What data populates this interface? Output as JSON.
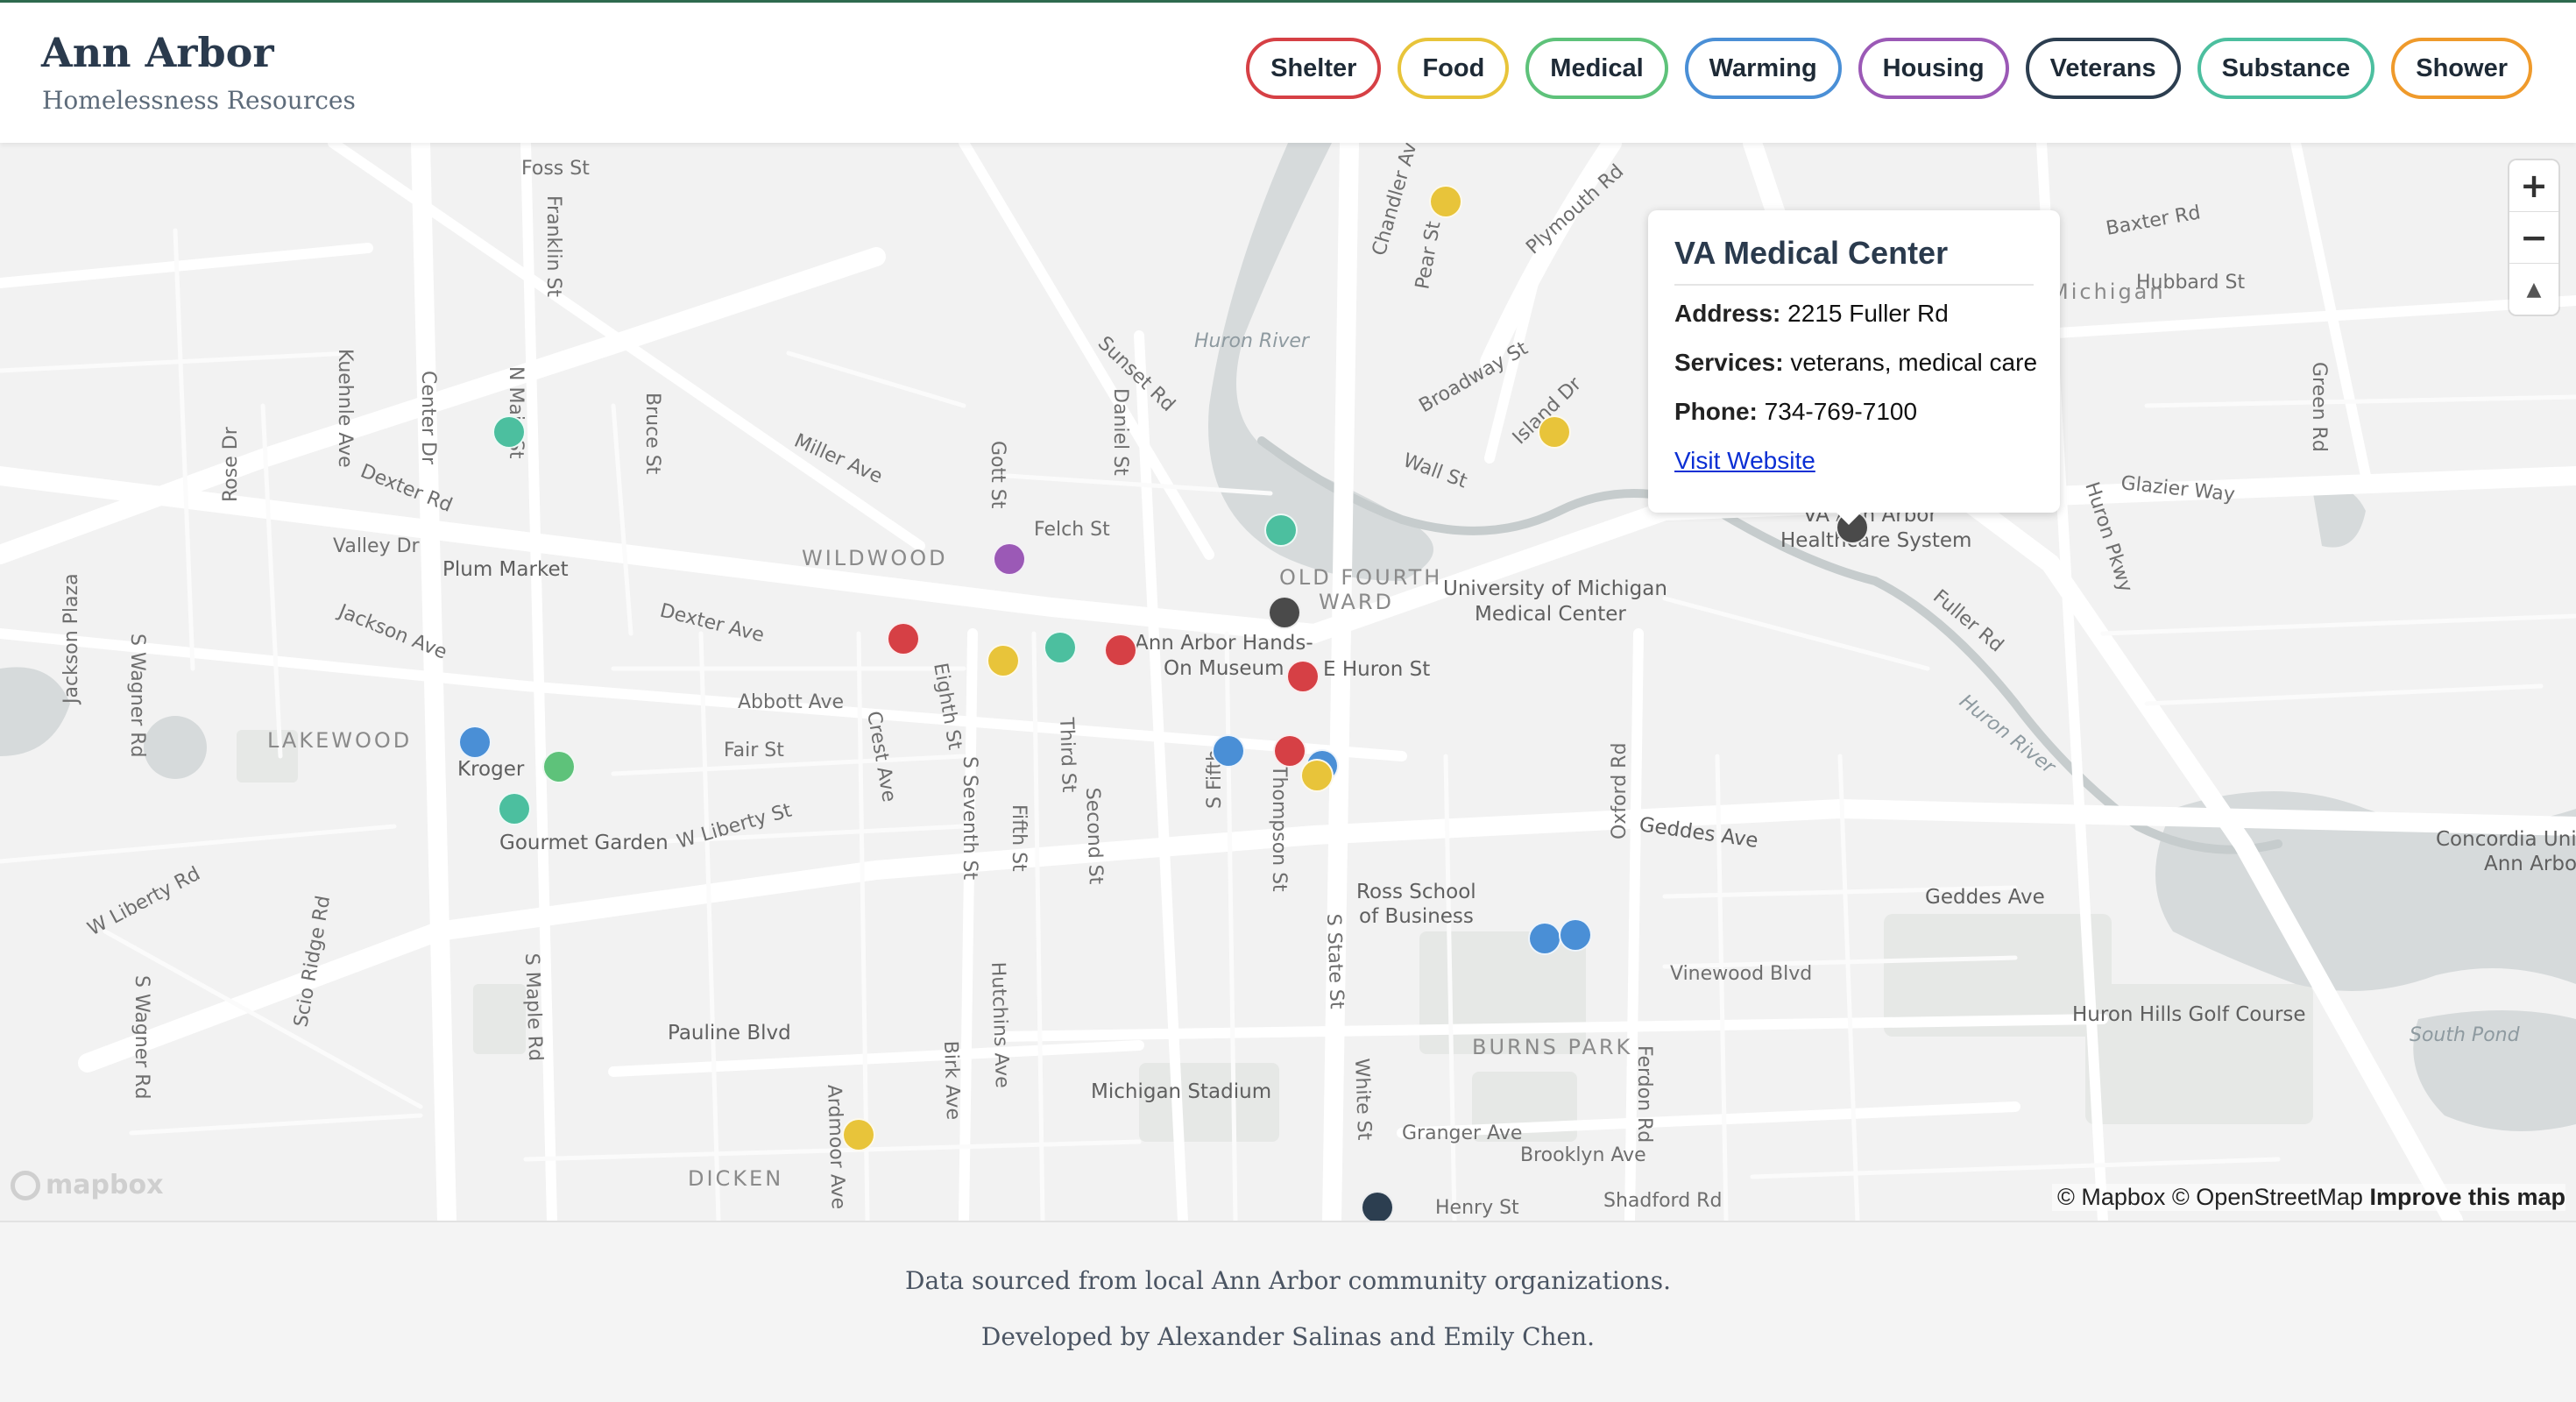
{
  "header": {
    "title": "Ann Arbor",
    "subtitle": "Homelessness Resources"
  },
  "filters": [
    {
      "label": "Shelter",
      "color": "#d64045"
    },
    {
      "label": "Food",
      "color": "#e8c43a"
    },
    {
      "label": "Medical",
      "color": "#5ec27a"
    },
    {
      "label": "Warming",
      "color": "#4a8fd6"
    },
    {
      "label": "Housing",
      "color": "#9b59b6"
    },
    {
      "label": "Veterans",
      "color": "#2c3e50"
    },
    {
      "label": "Substance",
      "color": "#4cbf9f"
    },
    {
      "label": "Shower",
      "color": "#ef9a2b"
    }
  ],
  "map": {
    "controls": {
      "zoom_in": "+",
      "zoom_out": "−",
      "compass": "▲"
    },
    "labels": {
      "streets": [
        "Foss St",
        "Franklin St",
        "N Main St",
        "Kuehnle Ave",
        "Center Dr",
        "Bruce St",
        "Rose Dr",
        "Dexter Rd",
        "Valley Dr",
        "Plum Market",
        "Miller Ave",
        "Felch St",
        "Gott St",
        "Sunset Rd",
        "Daniel St",
        "Chandler Ave",
        "Pear St",
        "Plymouth Rd",
        "Broadway St",
        "Wall St",
        "Baxter Rd",
        "Hubbard St",
        "Green Rd",
        "Glazier Way",
        "Huron Pkwy",
        "Fuller Rd",
        "Jackson Ave",
        "Dexter Ave",
        "Jackson Plaza",
        "S Wagner Rd",
        "Abbott Ave",
        "Fair St",
        "Crest Ave",
        "Eighth St",
        "S Seventh St",
        "Third St",
        "Second St",
        "Fifth St",
        "S Fifth",
        "Thompson St",
        "E Huron St",
        "Kroger",
        "Gourmet Garden",
        "W Liberty St",
        "W Liberty Rd",
        "S Wagner Rd",
        "Scio Ridge Rd",
        "S Maple Rd",
        "Hutchins Ave",
        "Birk Ave",
        "Pauline Blvd",
        "Ardmoor Ave",
        "Michigan Stadium",
        "S State St",
        "White St",
        "Granger Ave",
        "Brooklyn Ave",
        "Henry St",
        "Shadford Rd",
        "Oxford Rd",
        "Ferdon Rd",
        "Geddes Ave",
        "Geddes Ave",
        "Vinewood Blvd",
        "Huron Hills Golf Course",
        "Ross School of Business",
        "Concordia University Ann Arbor",
        "Ann Arbor Hands-On Museum",
        "University of Michigan Medical Center",
        "VA Ann Arbor Healthcare System",
        "Island Dr"
      ],
      "areas": [
        "WILDWOOD",
        "OLD FOURTH WARD",
        "LAKEWOOD",
        "BURNS PARK",
        "DICKEN",
        "Michigan"
      ],
      "water": [
        "Huron River",
        "Huron River",
        "South Pond"
      ]
    },
    "markers": [
      {
        "category": "Food",
        "color": "#e8c43a"
      },
      {
        "category": "Food",
        "color": "#e8c43a"
      },
      {
        "category": "Substance",
        "color": "#4cbf9f"
      },
      {
        "category": "Substance",
        "color": "#4cbf9f"
      },
      {
        "category": "Housing",
        "color": "#9b59b6"
      },
      {
        "category": "Veterans",
        "color": "#4a4a4a"
      },
      {
        "category": "Veterans",
        "color": "#4a4a4a"
      },
      {
        "category": "Shelter",
        "color": "#d64045"
      },
      {
        "category": "Food",
        "color": "#e8c43a"
      },
      {
        "category": "Substance",
        "color": "#4cbf9f"
      },
      {
        "category": "Shelter",
        "color": "#d64045"
      },
      {
        "category": "Shelter",
        "color": "#d64045"
      },
      {
        "category": "Warming",
        "color": "#4a8fd6"
      },
      {
        "category": "Shelter",
        "color": "#d64045"
      },
      {
        "category": "Warming",
        "color": "#4a8fd6"
      },
      {
        "category": "Food",
        "color": "#e8c43a"
      },
      {
        "category": "Warming",
        "color": "#4a8fd6"
      },
      {
        "category": "Medical",
        "color": "#5ec27a"
      },
      {
        "category": "Substance",
        "color": "#4cbf9f"
      },
      {
        "category": "Warming",
        "color": "#4a8fd6"
      },
      {
        "category": "Warming",
        "color": "#4a8fd6"
      },
      {
        "category": "Food",
        "color": "#e8c43a"
      },
      {
        "category": "Veterans",
        "color": "#2c3e50"
      }
    ],
    "logo": "mapbox",
    "attribution": {
      "text": "© Mapbox © OpenStreetMap",
      "link": "Improve this map"
    }
  },
  "popup": {
    "title": "VA Medical Center",
    "address_label": "Address:",
    "address": "2215 Fuller Rd",
    "services_label": "Services:",
    "services": "veterans, medical care",
    "phone_label": "Phone:",
    "phone": "734-769-7100",
    "link_label": "Visit Website"
  },
  "footer": {
    "line1": "Data sourced from local Ann Arbor community organizations.",
    "line2": "Developed by Alexander Salinas and Emily Chen."
  }
}
